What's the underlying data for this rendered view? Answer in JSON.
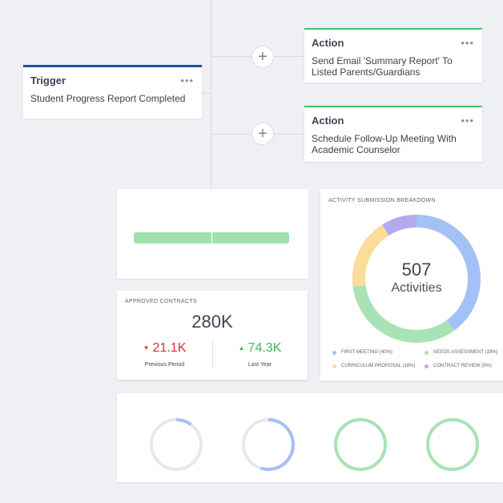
{
  "trigger": {
    "title": "Trigger",
    "menu": "•••",
    "text": "Student Progress Report Completed"
  },
  "actions": [
    {
      "title": "Action",
      "menu": "•••",
      "text": "Send Email 'Summary Report' To Listed Parents/Guardians"
    },
    {
      "title": "Action",
      "menu": "•••",
      "text": "Schedule Follow-Up Meeting With Academic Counselor"
    }
  ],
  "add_step_label": "+",
  "progress": {
    "fill_fraction": 1.0,
    "split_fraction": 0.5,
    "fill_color": "#a0e1ad",
    "track_color": "#e6e8ec"
  },
  "contracts": {
    "heading": "APPROVED CONTRACTS",
    "total": "280K",
    "previous": {
      "value": "21.1K",
      "label": "Previous Period",
      "arrow": "▼",
      "color": "#e0293b"
    },
    "last_year": {
      "value": "74.3K",
      "label": "Last Year",
      "arrow": "▲",
      "color": "#3cb65a"
    }
  },
  "breakdown": {
    "heading": "ACTIVITY SUBMISSION BREAKDOWN",
    "total": "507",
    "total_label": "Activities",
    "segments": [
      {
        "label": "FIRST MEETING (40%)",
        "share": 40,
        "color": "#a3c1f5"
      },
      {
        "label": "NEEDS ASSESSMENT (33%)",
        "share": 33,
        "color": "#a9e3b5"
      },
      {
        "label": "CURRICULUM PROPOSAL (18%)",
        "share": 18,
        "color": "#fbdc98"
      },
      {
        "label": "CONTRACT REVIEW (9%)",
        "share": 9,
        "color": "#b5a9ed"
      }
    ]
  },
  "rings": [
    {
      "fraction": 0.1,
      "color": "#a3c1f5",
      "track": "#e6e8ec"
    },
    {
      "fraction": 0.55,
      "color": "#a3c1f5",
      "track": "#e6e8ec"
    },
    {
      "fraction": 1.0,
      "color": "#a9e3b5",
      "track": "#e6e8ec"
    },
    {
      "fraction": 1.0,
      "color": "#a9e3b5",
      "track": "#e6e8ec"
    }
  ]
}
